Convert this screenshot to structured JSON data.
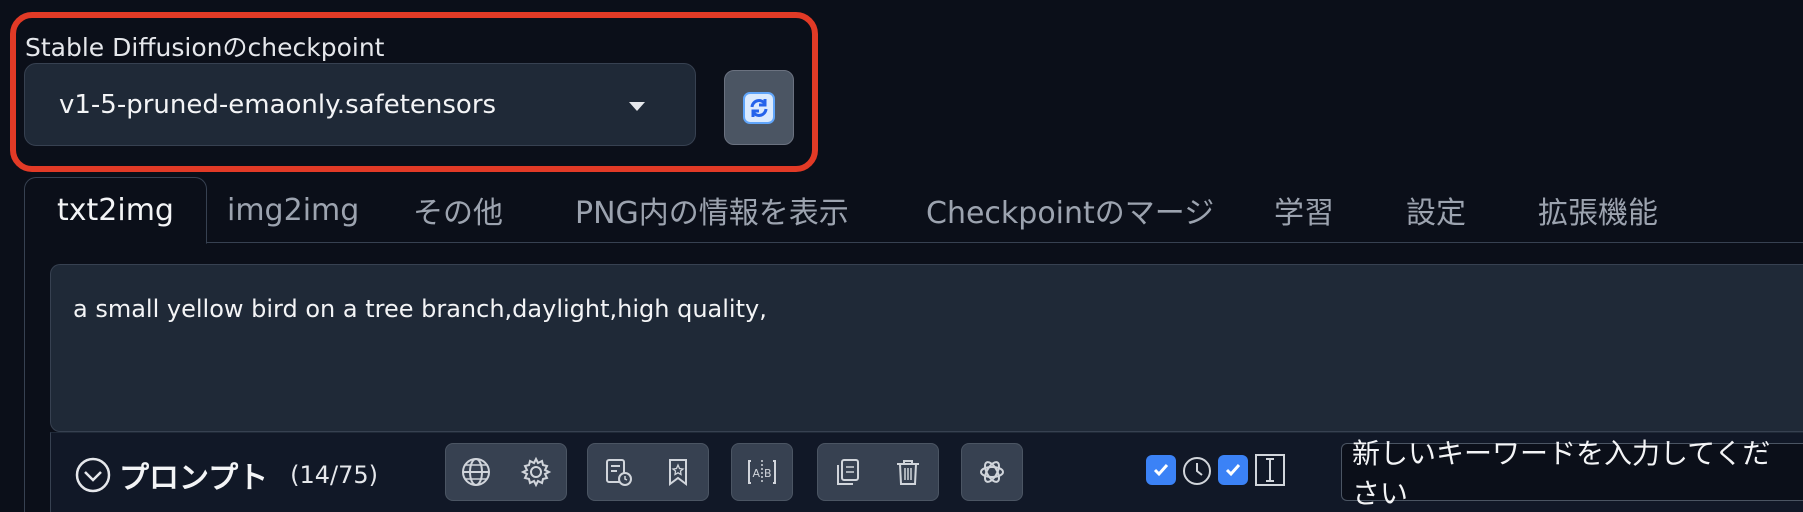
{
  "checkpoint": {
    "label": "Stable Diffusionのcheckpoint",
    "selected": "v1-5-pruned-emaonly.safetensors",
    "highlight_color": "#e23a26"
  },
  "tabs": [
    {
      "label": "txt2img",
      "active": true
    },
    {
      "label": "img2img"
    },
    {
      "label": "その他"
    },
    {
      "label": "PNG内の情報を表示"
    },
    {
      "label": "Checkpointのマージ"
    },
    {
      "label": "学習"
    },
    {
      "label": "設定"
    },
    {
      "label": "拡張機能"
    }
  ],
  "prompt": {
    "text": "a small yellow bird on a tree branch,daylight,high quality,",
    "section_title": "プロンプト",
    "token_count": "(14/75)"
  },
  "toolbar": {
    "icons": [
      "globe-icon",
      "gear-icon",
      "history-icon",
      "bookmark-icon",
      "text-compare-icon",
      "copy-icon",
      "trash-icon",
      "openai-icon"
    ],
    "checkbox_color": "#3b82f6",
    "keyword_input": "新しいキーワードを入力してください"
  }
}
